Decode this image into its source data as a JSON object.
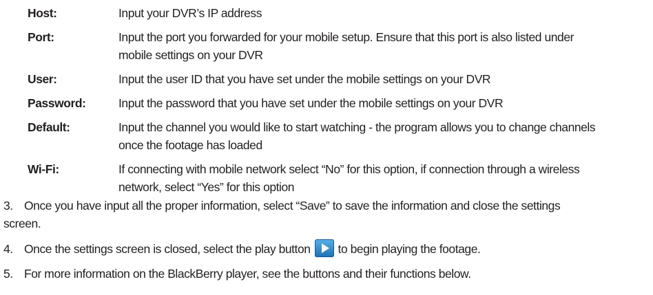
{
  "definitions": [
    {
      "term": "Host:",
      "lines": [
        "Input your DVR’s IP address"
      ]
    },
    {
      "term": "Port:",
      "lines": [
        "Input the port you forwarded for your mobile setup. Ensure that this port is also listed under",
        "mobile settings on your DVR"
      ]
    },
    {
      "term": "User:",
      "lines": [
        "Input the user ID that you have set under the mobile settings on your DVR"
      ]
    },
    {
      "term": "Password:",
      "lines": [
        "Input the password that you have set under the mobile settings on your DVR"
      ]
    },
    {
      "term": "Default:",
      "lines": [
        "Input the channel you would like to start watching - the program allows you to change channels",
        "once the footage has loaded"
      ]
    },
    {
      "term": "Wi-Fi:",
      "lines": [
        "If connecting with mobile network select “No” for this option, if connection through a wireless",
        "network, select “Yes” for this option"
      ]
    }
  ],
  "steps": [
    {
      "num": "3.",
      "line1": "Once you have input all the proper information, select “Save” to save the information and close the settings",
      "line2": "screen."
    },
    {
      "num": "4.",
      "before": "Once the settings screen is closed, select the play button",
      "after": "to begin playing the footage.",
      "icon": "play-icon"
    },
    {
      "num": "5.",
      "line1": "For more information on the BlackBerry player, see the buttons and their functions below."
    }
  ]
}
